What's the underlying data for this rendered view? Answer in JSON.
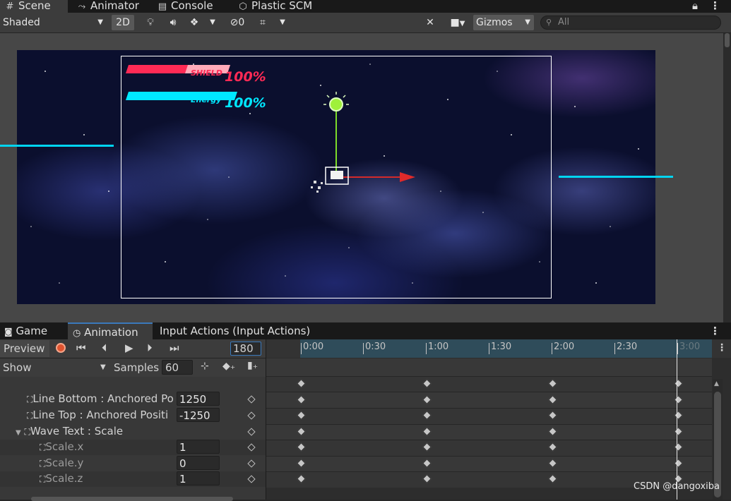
{
  "top_tabs": [
    {
      "label": "Scene",
      "icon": "hash-icon"
    },
    {
      "label": "Animator",
      "icon": "animator-icon"
    },
    {
      "label": "Console",
      "icon": "console-icon"
    },
    {
      "label": "Plastic SCM",
      "icon": "plastic-scm-icon"
    }
  ],
  "scene_toolbar": {
    "shading_mode": "Shaded",
    "mode_2d": "2D",
    "hidden_count": "0",
    "gizmos": "Gizmos",
    "search_placeholder": "All"
  },
  "hud": {
    "shield_label": "SHIELD",
    "shield_value": "100%",
    "energy_label": "Energy",
    "energy_value": "100%"
  },
  "bottom_tabs": [
    {
      "label": "Game",
      "icon": "gamepad-icon"
    },
    {
      "label": "Animation",
      "icon": "clock-icon"
    },
    {
      "label": "Input Actions (Input Actions)",
      "icon": ""
    }
  ],
  "animation": {
    "preview_label": "Preview",
    "frame": "180",
    "show_label": "Show",
    "samples_label": "Samples",
    "samples_value": "60",
    "ruler_ticks": [
      "0:00",
      "0:30",
      "1:00",
      "1:30",
      "2:00",
      "2:30",
      "3:00"
    ],
    "properties": [
      {
        "name": "Line Bottom : Anchored Po",
        "value": "1250",
        "indent": 1
      },
      {
        "name": "Line Top : Anchored Positi",
        "value": "-1250",
        "indent": 1
      },
      {
        "name": "Wave Text : Scale",
        "value": "",
        "indent": 0
      },
      {
        "name": "Scale.x",
        "value": "1",
        "indent": 2
      },
      {
        "name": "Scale.y",
        "value": "0",
        "indent": 2
      },
      {
        "name": "Scale.z",
        "value": "1",
        "indent": 2
      }
    ],
    "keyframe_times": [
      "0:00",
      "1:00",
      "2:00",
      "3:00"
    ]
  },
  "watermark": "CSDN @dangoxiba",
  "colors": {
    "accent_blue": "#2f4c5a",
    "record_red": "#e0532f",
    "shield_red": "#ff2a55",
    "energy_cyan": "#00e7ff"
  }
}
